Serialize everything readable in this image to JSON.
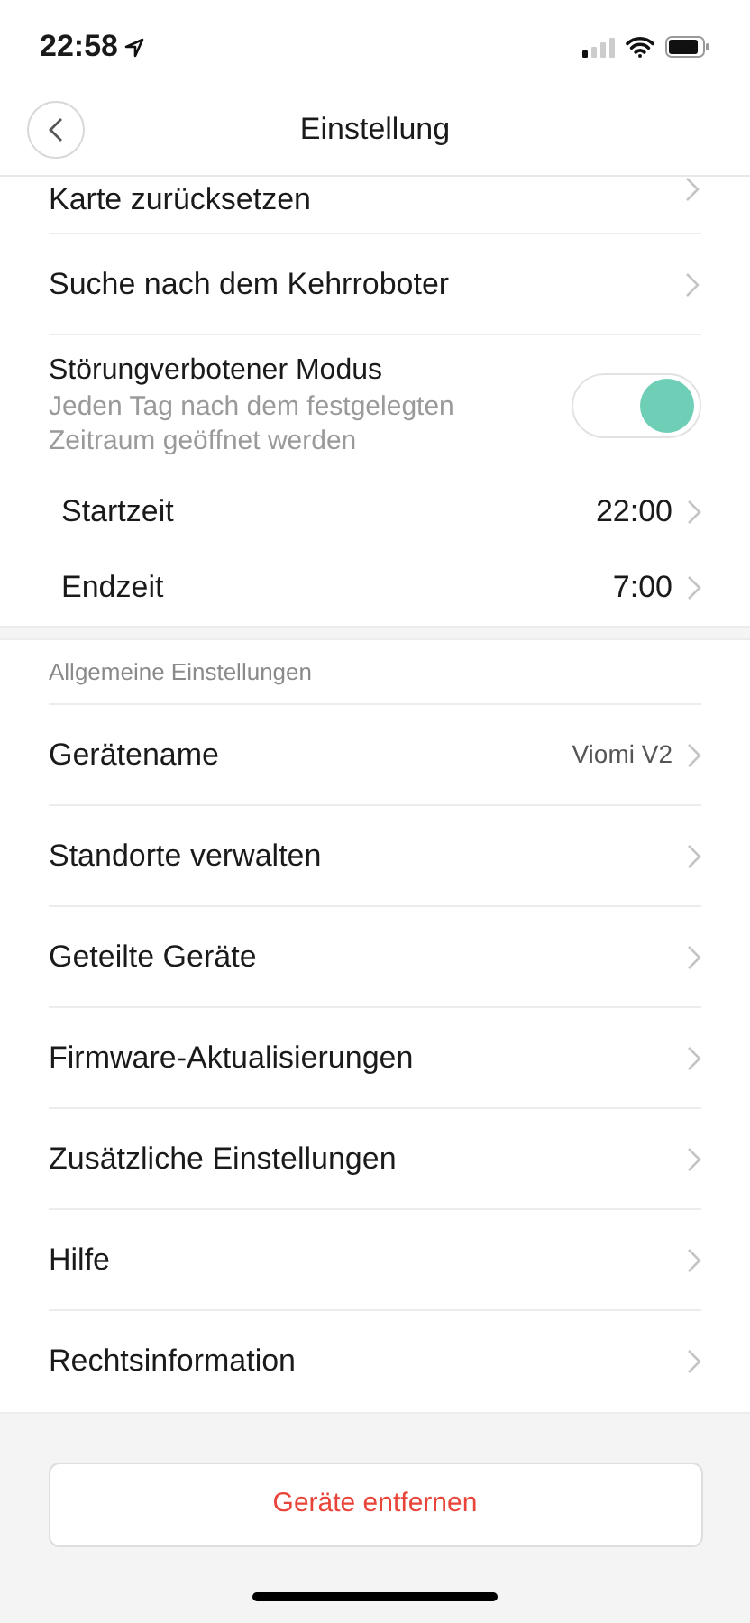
{
  "status_bar": {
    "time": "22:58"
  },
  "header": {
    "title": "Einstellung"
  },
  "top_rows": [
    {
      "kind": "link",
      "label": "Karte zurücksetzen"
    },
    {
      "kind": "link",
      "label": "Suche nach dem Kehrroboter"
    },
    {
      "kind": "toggle",
      "label": "Störungverbotener Modus",
      "description": "Jeden Tag nach dem festgelegten Zeitraum geöffnet werden",
      "on": true
    },
    {
      "kind": "time",
      "label": "Startzeit",
      "value": "22:00"
    },
    {
      "kind": "time",
      "label": "Endzeit",
      "value": "7:00"
    }
  ],
  "general": {
    "heading": "Allgemeine Einstellungen",
    "rows": [
      {
        "label": "Gerätename",
        "value": "Viomi V2"
      },
      {
        "label": "Standorte verwalten"
      },
      {
        "label": "Geteilte Geräte"
      },
      {
        "label": "Firmware-Aktualisierungen"
      },
      {
        "label": "Zusätzliche Einstellungen"
      },
      {
        "label": "Hilfe"
      },
      {
        "label": "Rechtsinformation"
      }
    ]
  },
  "remove_button": "Geräte entfernen"
}
